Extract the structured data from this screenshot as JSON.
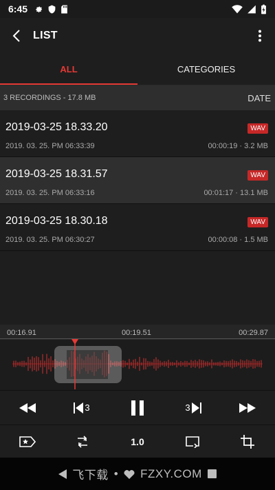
{
  "status_bar": {
    "time": "6:45"
  },
  "app_bar": {
    "title": "LIST"
  },
  "tabs": [
    {
      "label": "ALL",
      "active": true
    },
    {
      "label": "CATEGORIES",
      "active": false
    }
  ],
  "summary": {
    "text": "3 RECORDINGS - 17.8 MB",
    "sort_label": "DATE"
  },
  "recordings": [
    {
      "title": "2019-03-25 18.33.20",
      "date": "2019. 03. 25. PM 06:33:39",
      "meta": "00:00:19 · 3.2 MB",
      "format": "WAV",
      "selected": false
    },
    {
      "title": "2019-03-25 18.31.57",
      "date": "2019. 03. 25. PM 06:33:16",
      "meta": "00:01:17 · 13.1 MB",
      "format": "WAV",
      "selected": true
    },
    {
      "title": "2019-03-25 18.30.18",
      "date": "2019. 03. 25. PM 06:30:27",
      "meta": "00:00:08 · 1.5 MB",
      "format": "WAV",
      "selected": false
    }
  ],
  "timeline": {
    "start": "00:16.91",
    "middle": "00:19.51",
    "end": "00:29.87"
  },
  "player": {
    "rewind_label": "3",
    "forward_label": "3"
  },
  "toolbar": {
    "speed": "1.0"
  },
  "nav_bar": {
    "watermark_left": "飞下载",
    "watermark_right": "FZXY.COM"
  },
  "colors": {
    "accent": "#e53935",
    "badge": "#c62828",
    "waveform": "#d32f2f"
  }
}
